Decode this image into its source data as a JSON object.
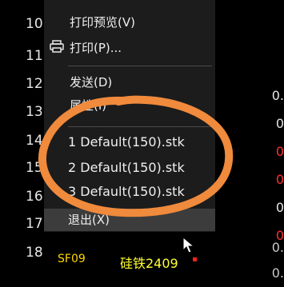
{
  "rows": {
    "r10": "10",
    "r11": "11",
    "r12": "12",
    "r13": "13",
    "r14": "14",
    "r15": "15",
    "r16": "16",
    "r17": "17",
    "r18": "18"
  },
  "menu": {
    "print_preview": "打印预览(V)",
    "print": "打印(P)...",
    "send": "发送(D)",
    "properties": "属性(I)",
    "recent1": "1 Default(150).stk",
    "recent2": "2 Default(150).stk",
    "recent3": "3 Default(150).stk",
    "exit": "退出(X)"
  },
  "bottom_row": {
    "code": "SF09",
    "name": "硅铁2409"
  },
  "right_values": {
    "v1": "0.",
    "v2": "0",
    "v3": "0",
    "v4": "0",
    "v5": "0",
    "v6": "0",
    "v7": "0.",
    "v8": "0."
  },
  "colors": {
    "highlight_circle": "#f08a3c",
    "code_yellow": "#ffd700"
  },
  "icons": {
    "printer": "printer-icon",
    "cursor": "mouse-cursor-icon"
  }
}
